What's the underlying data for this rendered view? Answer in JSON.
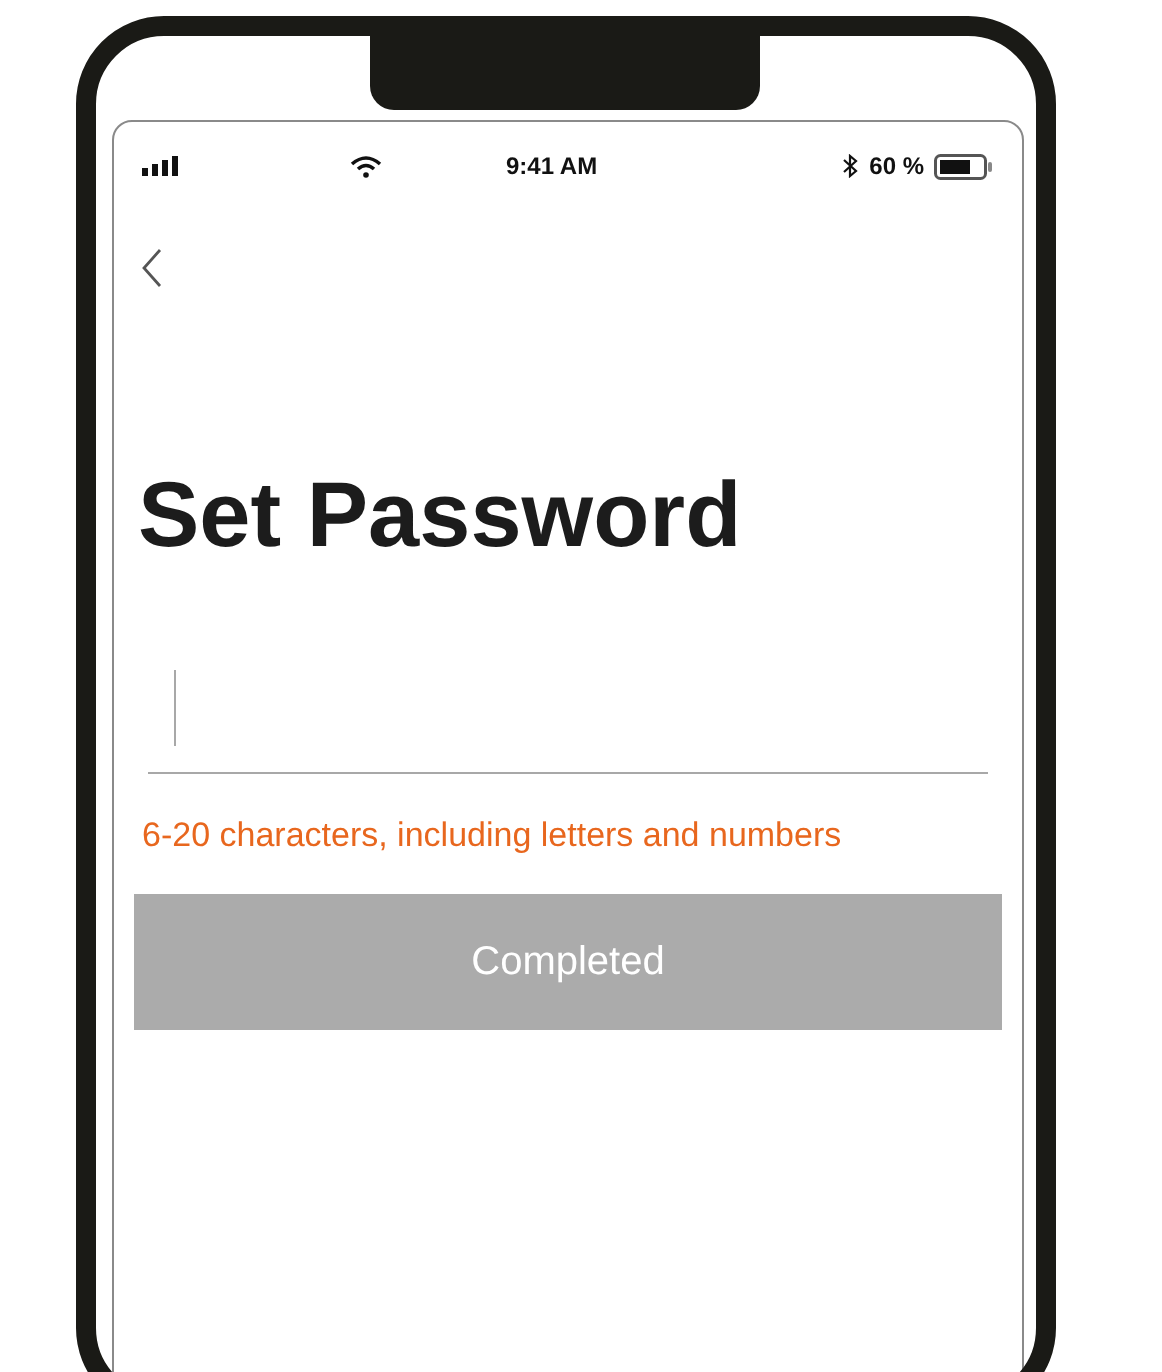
{
  "status_bar": {
    "time": "9:41 AM",
    "battery": "60 %"
  },
  "title": "Set Password",
  "hint": "6-20 characters, including letters and numbers",
  "submit_button": {
    "label": "Completed",
    "disabled": true
  }
}
